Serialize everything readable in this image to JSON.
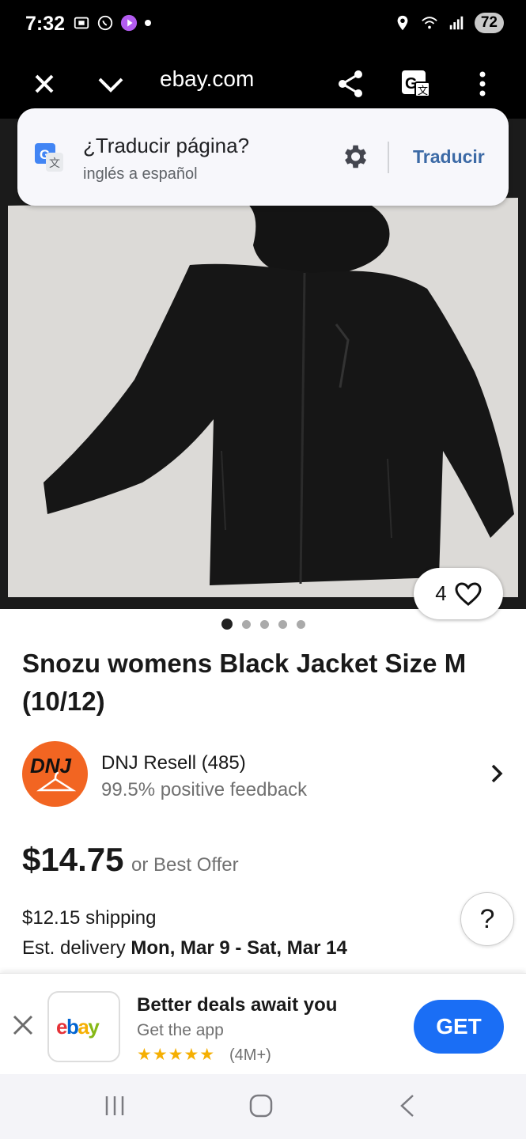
{
  "status_bar": {
    "time": "7:32",
    "battery": "72",
    "icons": [
      "screenshot-icon",
      "whatsapp-icon",
      "video-icon",
      "dot-icon",
      "location-icon",
      "wifi-icon",
      "signal-icon",
      "battery-icon"
    ]
  },
  "browser": {
    "url": "ebay.com",
    "icons": [
      "close-icon",
      "chevron-down-icon",
      "share-icon",
      "translate-icon",
      "more-icon"
    ]
  },
  "translate_prompt": {
    "title": "¿Traducir página?",
    "subtitle": "inglés a español",
    "button": "Traducir"
  },
  "gallery": {
    "like_count": "4",
    "image_count": 5,
    "active_index": 0
  },
  "listing": {
    "title": "Snozu womens Black Jacket Size M (10/12)",
    "seller_logo_text": "DNJ",
    "seller_name": "DNJ Resell (485)",
    "seller_feedback": "99.5% positive feedback",
    "price": "$14.75",
    "offer_text": "or Best Offer",
    "shipping": "$12.15 shipping",
    "delivery_label": "Est. delivery",
    "delivery_dates": "Mon, Mar 9 - Sat, Mar 14",
    "help_label": "?"
  },
  "app_banner": {
    "title": "Better deals await you",
    "subtitle": "Get the app",
    "rating_stars": 5,
    "rating_count": "(4M+)",
    "button": "GET",
    "app_name": "ebay"
  },
  "colors": {
    "ebay_red": "#e53238",
    "ebay_blue": "#0064d2",
    "ebay_yellow": "#f5af02",
    "ebay_green": "#86b817",
    "get_button": "#1a6ef5",
    "seller_logo": "#f26522",
    "translate_button": "#3c6aa6"
  }
}
